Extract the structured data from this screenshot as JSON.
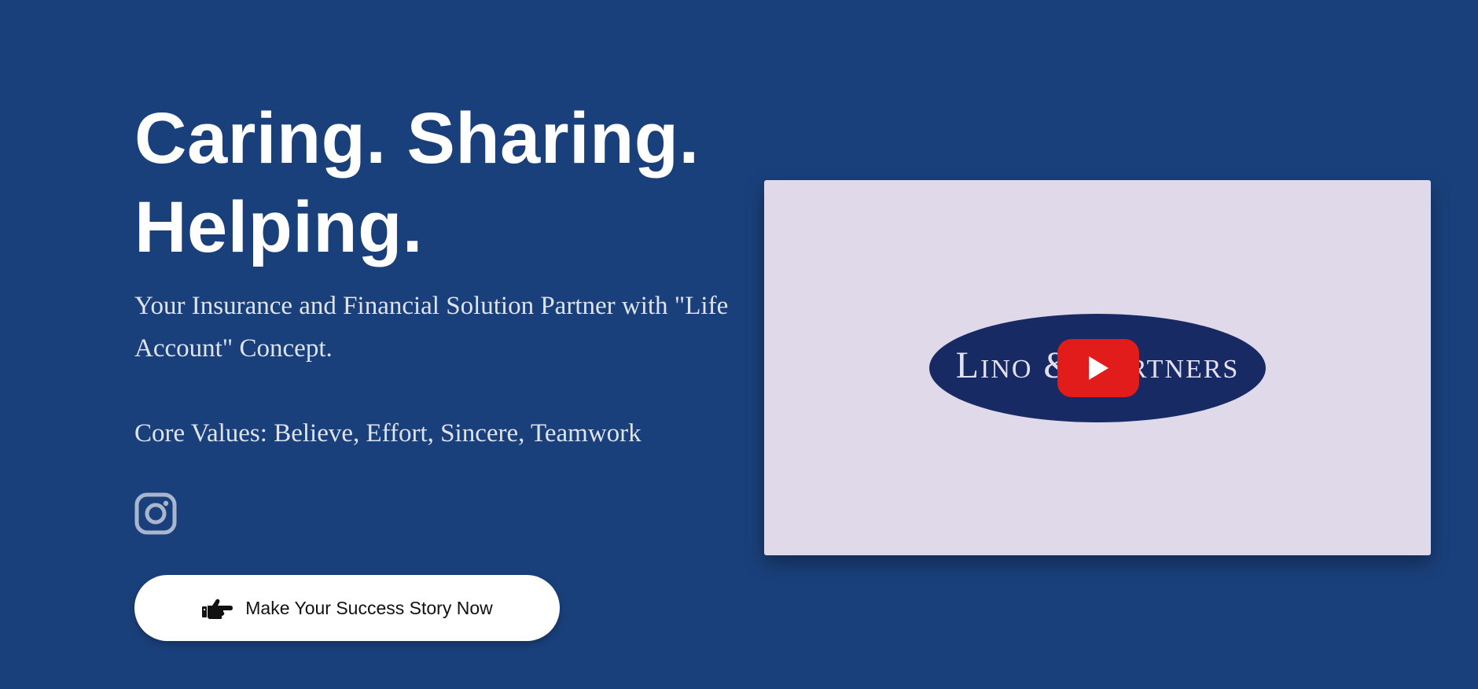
{
  "hero": {
    "headline_line1": "Caring. Sharing.",
    "headline_line2": "Helping.",
    "tagline": "Your Insurance and Financial Solution Partner with \"Life Account\" Concept.",
    "core_values": "Core Values: Believe, Effort, Sincere, Teamwork",
    "social_icon": "instagram-icon",
    "cta": {
      "icon": "pointing-hand-icon",
      "label": "Make Your Success Story Now"
    }
  },
  "video": {
    "logo_text": "Lino & Partners",
    "play_icon": "youtube-play-icon"
  },
  "colors": {
    "background": "#1a407b",
    "headline": "#ffffff",
    "body_text": "#dfe3ee",
    "button_bg": "#ffffff",
    "video_bg": "#dfd9ea",
    "logo_ellipse": "#172a63",
    "play_button": "#e21b1b"
  }
}
